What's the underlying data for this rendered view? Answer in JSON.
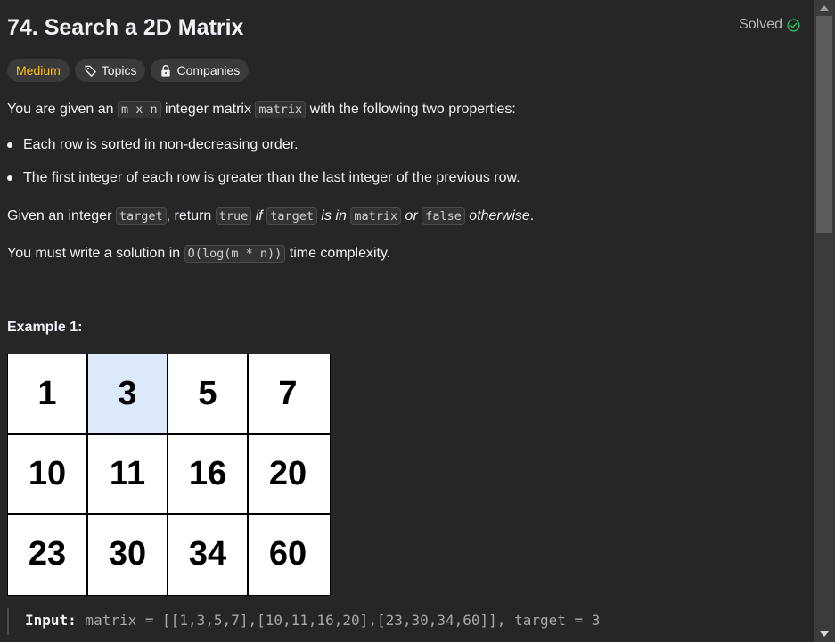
{
  "problem": {
    "title": "74. Search a 2D Matrix",
    "status": "Solved"
  },
  "tags": {
    "difficulty": "Medium",
    "topics": "Topics",
    "companies": "Companies"
  },
  "description": {
    "intro_1": "You are given an ",
    "intro_code_1": "m x n",
    "intro_2": " integer matrix ",
    "intro_code_2": "matrix",
    "intro_3": " with the following two properties:",
    "bullets": [
      "Each row is sorted in non-decreasing order.",
      "The first integer of each row is greater than the last integer of the previous row."
    ],
    "task_1": "Given an integer ",
    "task_code_1": "target",
    "task_2": ", return ",
    "task_code_2": "true",
    "task_em_1": " if ",
    "task_code_3": "target",
    "task_em_2": " is in ",
    "task_code_4": "matrix",
    "task_em_3": " or ",
    "task_code_5": "false",
    "task_em_4": " otherwise",
    "task_3": ".",
    "complexity_1": "You must write a solution in ",
    "complexity_code": "O(log(m * n))",
    "complexity_2": " time complexity."
  },
  "example": {
    "heading": "Example 1:",
    "matrix": [
      [
        "1",
        "3",
        "5",
        "7"
      ],
      [
        "10",
        "11",
        "16",
        "20"
      ],
      [
        "23",
        "30",
        "34",
        "60"
      ]
    ],
    "highlight_color": "#dce9fb",
    "input_label": "Input:",
    "input_value": " matrix = [[1,3,5,7],[10,11,16,20],[23,30,34,60]], target = 3"
  },
  "colors": {
    "background": "#262626",
    "medium": "#ffc01e",
    "solved_check": "#2cbb5d"
  }
}
